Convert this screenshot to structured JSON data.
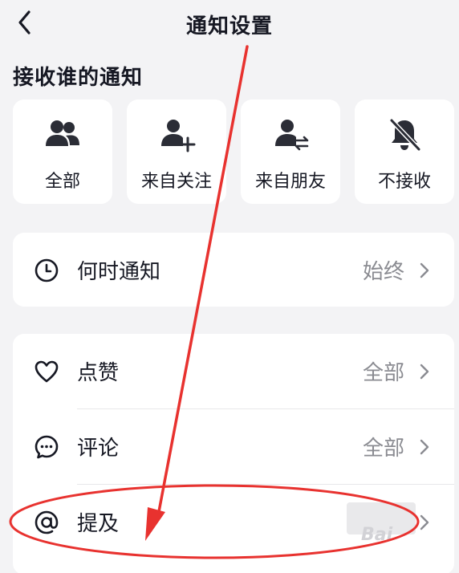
{
  "header": {
    "title": "通知设置"
  },
  "section": {
    "title": "接收谁的通知"
  },
  "options": [
    {
      "label": "全部",
      "icon": "group-icon"
    },
    {
      "label": "来自关注",
      "icon": "person-add-icon"
    },
    {
      "label": "来自朋友",
      "icon": "person-swap-icon"
    },
    {
      "label": "不接收",
      "icon": "bell-off-icon"
    }
  ],
  "when": {
    "label": "何时通知",
    "value": "始终",
    "icon": "clock-icon"
  },
  "types": [
    {
      "label": "点赞",
      "value": "全部",
      "icon": "heart-icon"
    },
    {
      "label": "评论",
      "value": "全部",
      "icon": "comment-icon"
    },
    {
      "label": "提及",
      "value": "",
      "icon": "at-icon"
    }
  ],
  "watermark": "Bai"
}
